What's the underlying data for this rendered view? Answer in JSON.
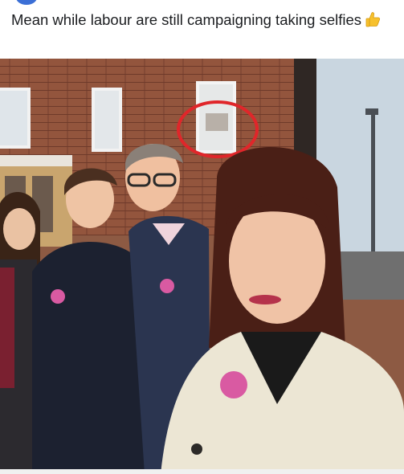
{
  "post": {
    "text": "Mean while labour are still campaigning taking selfies",
    "emoji_icon": "thumbs-up-emoji"
  },
  "photo": {
    "description_icon": "group-selfie-photo",
    "highlight_color": "#e0262a"
  }
}
